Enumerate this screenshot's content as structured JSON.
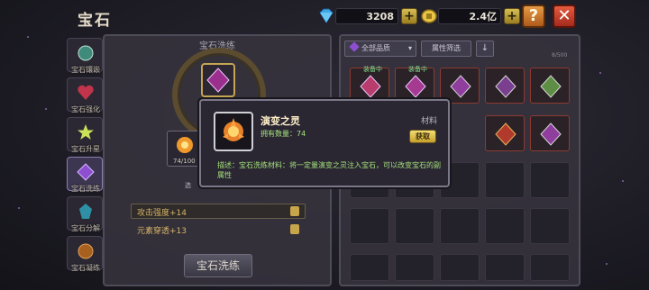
{
  "header": {
    "title": "宝石"
  },
  "currencies": [
    {
      "value": "3208",
      "icon": "diamond-icon",
      "color": "#3fa9e8"
    },
    {
      "value": "2.4亿",
      "icon": "gold-coin-icon",
      "color": "#e8c546"
    }
  ],
  "sidebar": {
    "items": [
      {
        "label": "宝石镶嵌",
        "icon": "socket-icon",
        "active": false
      },
      {
        "label": "宝石强化",
        "icon": "heart-gem-icon",
        "active": false
      },
      {
        "label": "宝石升星",
        "icon": "star-icon",
        "active": false
      },
      {
        "label": "宝石洗练",
        "icon": "wash-gem-icon",
        "active": true
      },
      {
        "label": "宝石分解",
        "icon": "decompose-icon",
        "active": false
      },
      {
        "label": "宝石凝练",
        "icon": "refine-icon",
        "active": false
      }
    ]
  },
  "wash_panel": {
    "title": "宝石洗练",
    "material_count": "74/100",
    "select_hint": "选",
    "stats": [
      "攻击强度+14",
      "元素穿透+13"
    ],
    "wash_button": "宝石洗练"
  },
  "inventory": {
    "quality_filter": "全部品质",
    "attr_filter": "属性筛选",
    "count": "8/500",
    "equipped_tag": "装备中"
  },
  "tooltip": {
    "name": "演变之灵",
    "type": "材料",
    "count_label": "拥有数量：",
    "count": "74",
    "get_button": "获取",
    "desc": "描述：宝石洗练材料：将一定量演变之灵注入宝石，可以改变宝石的副属性"
  }
}
